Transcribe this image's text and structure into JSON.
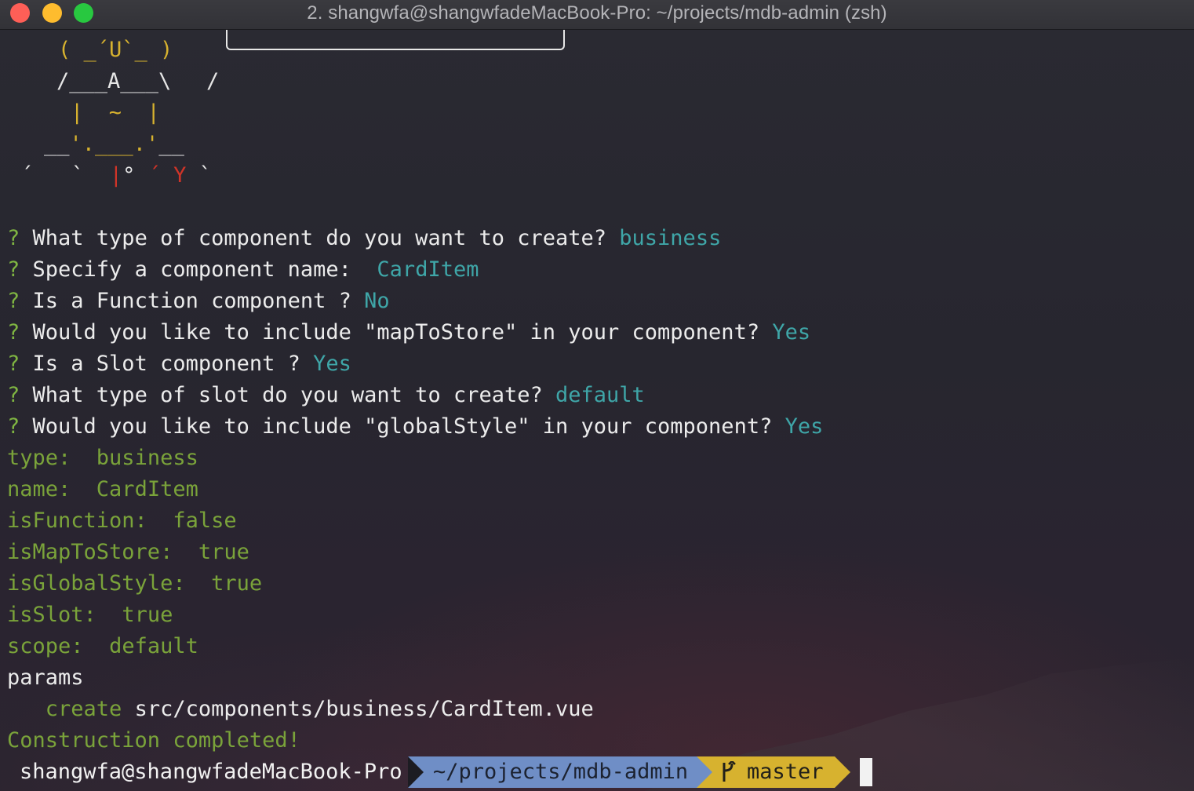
{
  "window": {
    "title": "2. shangwfa@shangwfadeMacBook-Pro: ~/projects/mdb-admin (zsh)"
  },
  "ascii_art": {
    "line1": "( _´U`_ )",
    "line2a": "/___A___\\",
    "line2b": "/",
    "line3": "|  ~  |",
    "line4": "__'.___.'__",
    "line5a": "´   `  ",
    "line5b": "|",
    "line5c": "° ",
    "line5d": "´ Y",
    "line5e": " `"
  },
  "questions": [
    {
      "mark": "?",
      "text": " What type of component do you want to create? ",
      "answer": "business"
    },
    {
      "mark": "?",
      "text": " Specify a component name:  ",
      "answer": "CardItem"
    },
    {
      "mark": "?",
      "text": " Is a Function component ? ",
      "answer": "No"
    },
    {
      "mark": "?",
      "text": " Would you like to include \"mapToStore\" in your component? ",
      "answer": "Yes"
    },
    {
      "mark": "?",
      "text": " Is a Slot component ? ",
      "answer": "Yes"
    },
    {
      "mark": "?",
      "text": " What type of slot do you want to create? ",
      "answer": "default"
    },
    {
      "mark": "?",
      "text": " Would you like to include \"globalStyle\" in your component? ",
      "answer": "Yes"
    }
  ],
  "params": [
    {
      "key": "type:",
      "value": "business"
    },
    {
      "key": "name:",
      "value": "CardItem"
    },
    {
      "key": "isFunction:",
      "value": "false"
    },
    {
      "key": "isMapToStore:",
      "value": "true"
    },
    {
      "key": "isGlobalStyle:",
      "value": "true"
    },
    {
      "key": "isSlot:",
      "value": "true"
    },
    {
      "key": "scope:",
      "value": "default"
    }
  ],
  "params_label": "params",
  "create_line": {
    "action": "create",
    "path": "src/components/business/CardItem.vue"
  },
  "completed": "Construction completed!",
  "prompt": {
    "user_host": "shangwfa@shangwfadeMacBook-Pro",
    "path": "~/projects/mdb-admin",
    "branch": "master",
    "branch_icon": "git-branch-icon"
  },
  "colors": {
    "question_mark": "#7fb542",
    "answer": "#3fa6a8",
    "param": "#7aa33a",
    "path_segment": "#6f8ec6",
    "git_segment": "#d7b22f",
    "ascii_yellow": "#d7b22f",
    "ascii_red": "#d03428"
  }
}
